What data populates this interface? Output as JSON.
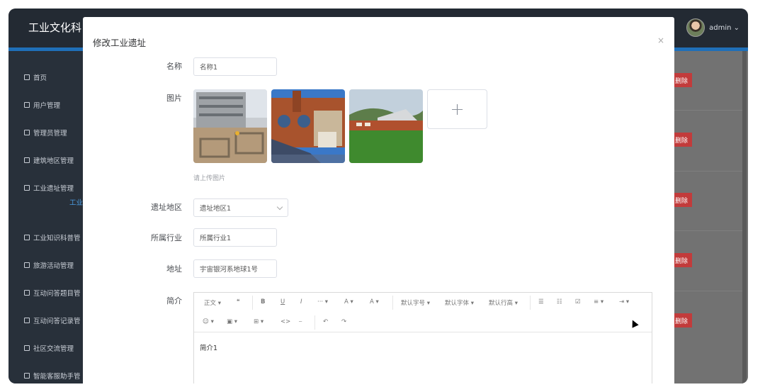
{
  "app": {
    "title": "工业文化科",
    "user_name": "admin ⌄"
  },
  "sidebar": {
    "items": [
      {
        "label": "首页",
        "icon": "home-icon"
      },
      {
        "label": "用户管理",
        "icon": "user-icon"
      },
      {
        "label": "管理员管理",
        "icon": "user-icon"
      },
      {
        "label": "建筑地区管理",
        "icon": "building-icon"
      },
      {
        "label": "工业遗址管理",
        "icon": "factory-icon"
      },
      {
        "label": "工业知识科普管",
        "icon": "book-icon"
      },
      {
        "label": "旅游活动管理",
        "icon": "flag-icon"
      },
      {
        "label": "互动问答题目管",
        "icon": "grid-icon"
      },
      {
        "label": "互动问答记录管",
        "icon": "grid-icon"
      },
      {
        "label": "社区交流管理",
        "icon": "chat-icon"
      },
      {
        "label": "智能客服助手管",
        "icon": "robot-icon"
      }
    ],
    "active_sub": "工业"
  },
  "background_table": {
    "delete_label": "删除"
  },
  "modal": {
    "title": "修改工业遗址",
    "close": "×",
    "fields": {
      "name_label": "名称",
      "name_value": "名称1",
      "image_label": "图片",
      "image_hint": "请上传图片",
      "upload_plus": "+",
      "region_label": "遗址地区",
      "region_value": "遗址地区1",
      "industry_label": "所属行业",
      "industry_value": "所属行业1",
      "address_label": "地址",
      "address_value": "宇宙银河系地球1号",
      "intro_label": "简介",
      "intro_value": "简介1"
    },
    "editor_toolbar": {
      "row1": [
        "正文 ▾",
        "❝",
        "B",
        "U",
        "I",
        "··· ▾",
        "A ▾",
        "A ▾",
        "默认字号 ▾",
        "默认字体 ▾",
        "默认行高 ▾",
        "☰",
        "☷",
        "☑",
        "≡ ▾",
        "⇥ ▾"
      ],
      "row2": [
        "☺ ▾",
        "▣ ▾",
        "⊞ ▾",
        "<>",
        "⎯",
        "↶",
        "↷"
      ]
    }
  }
}
